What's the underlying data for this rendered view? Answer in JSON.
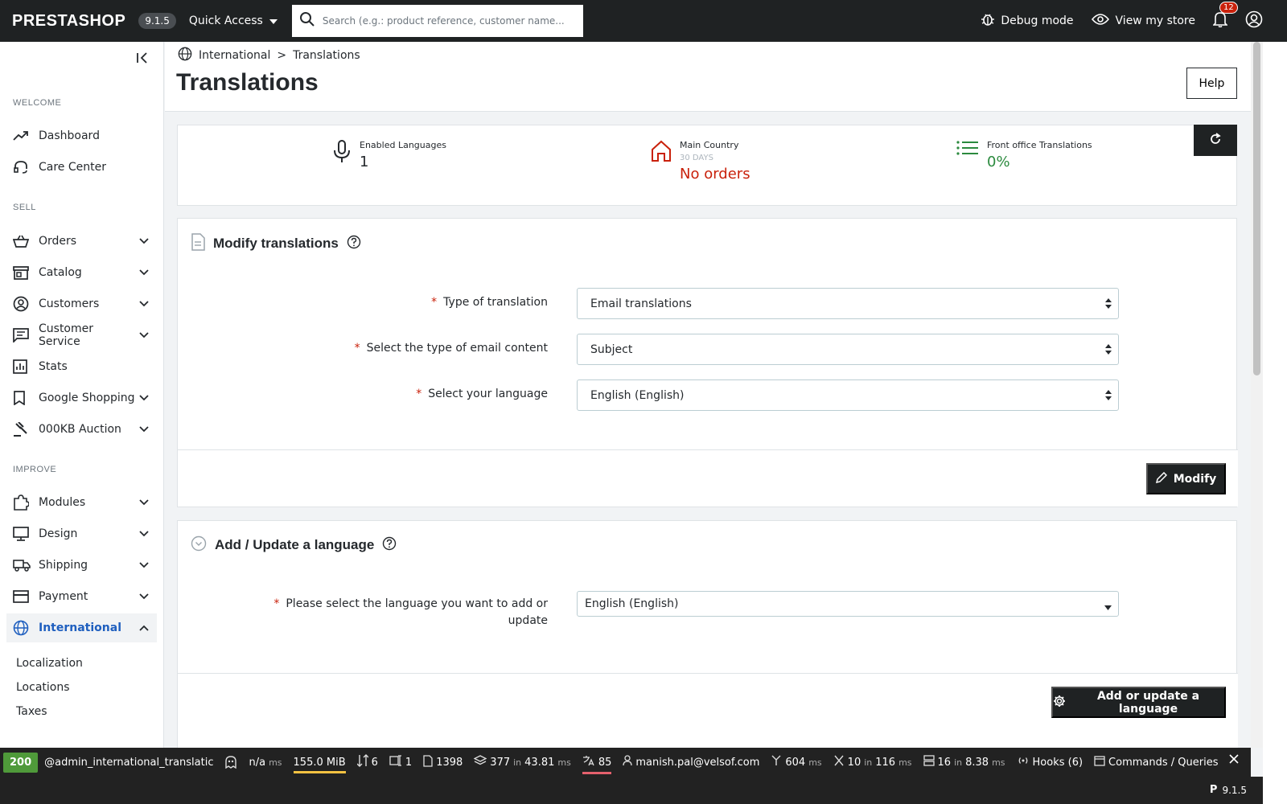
{
  "header": {
    "logo": "PRESTASHOP",
    "version": "9.1.5",
    "quick_access": "Quick Access",
    "search_placeholder": "Search (e.g.: product reference, customer name...)",
    "debug_mode": "Debug mode",
    "view_store": "View my store",
    "notifications_count": "12"
  },
  "sidebar": {
    "sections": {
      "welcome": "WELCOME",
      "sell": "SELL",
      "improve": "IMPROVE"
    },
    "items": {
      "dashboard": "Dashboard",
      "care_center": "Care Center",
      "orders": "Orders",
      "catalog": "Catalog",
      "customers": "Customers",
      "customer_service": "Customer Service",
      "stats": "Stats",
      "google_shopping": "Google Shopping",
      "auction": "000KB Auction",
      "modules": "Modules",
      "design": "Design",
      "shipping": "Shipping",
      "payment": "Payment",
      "international": "International"
    },
    "subitems": [
      "Localization",
      "Locations",
      "Taxes"
    ]
  },
  "breadcrumb": {
    "parent": "International",
    "separator": ">",
    "current": "Translations"
  },
  "page": {
    "title": "Translations",
    "help": "Help"
  },
  "kpis": {
    "enabled_languages": {
      "title": "Enabled Languages",
      "value": "1"
    },
    "main_country": {
      "title": "Main Country",
      "subtitle": "30 DAYS",
      "value": "No orders"
    },
    "front_office": {
      "title": "Front office Translations",
      "value": "0%"
    }
  },
  "modify_card": {
    "title": "Modify translations",
    "fields": {
      "type_label": "Type of translation",
      "type_value": "Email translations",
      "email_content_label": "Select the type of email content",
      "email_content_value": "Subject",
      "language_label": "Select your language",
      "language_value": "English (English)"
    },
    "submit": "Modify"
  },
  "add_card": {
    "title": "Add / Update a language",
    "field_label_line1": "Please select the language you want to add or",
    "field_label_line2": "update",
    "field_value": "English (English)",
    "submit": "Add or update a language"
  },
  "debugbar": {
    "status": "200",
    "route": "@admin_international_translatic",
    "time": "n/a",
    "time_unit": "ms",
    "memory": "155.0 MiB",
    "requests": "6",
    "forms": "1",
    "templates": "1398",
    "db_queries": "377",
    "db_in": "in",
    "db_time": "43.81",
    "db_unit": "ms",
    "translations": "85",
    "user": "manish.pal@velsof.com",
    "init_time": "604",
    "init_unit": "ms",
    "events": "10",
    "events_in": "in",
    "events_time": "116",
    "events_unit": "ms",
    "cache": "16",
    "cache_in": "in",
    "cache_time": "8.38",
    "cache_unit": "ms",
    "hooks": "Hooks (6)",
    "commands": "Commands / Queries",
    "footer_version": "9.1.5"
  },
  "colors": {
    "accent_blue": "#1f5fbf",
    "danger_red": "#c9210b",
    "success_green": "#2b8a3e",
    "dark": "#1f2223"
  }
}
